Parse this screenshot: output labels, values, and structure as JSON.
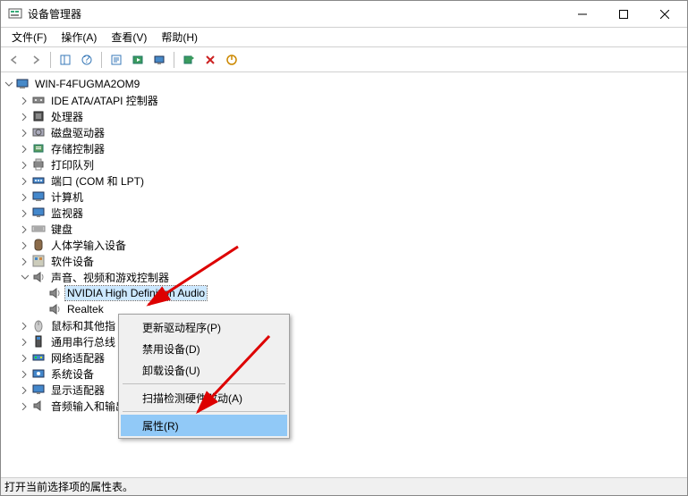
{
  "window": {
    "title": "设备管理器"
  },
  "menubar": {
    "file": "文件(F)",
    "action": "操作(A)",
    "view": "查看(V)",
    "help": "帮助(H)"
  },
  "statusbar": {
    "text": "打开当前选择项的属性表。"
  },
  "tree": {
    "root": "WIN-F4FUGMA2OM9",
    "nodes": [
      {
        "label": "IDE ATA/ATAPI 控制器",
        "icon": "ide"
      },
      {
        "label": "处理器",
        "icon": "cpu"
      },
      {
        "label": "磁盘驱动器",
        "icon": "disk"
      },
      {
        "label": "存储控制器",
        "icon": "storage"
      },
      {
        "label": "打印队列",
        "icon": "printer"
      },
      {
        "label": "端口 (COM 和 LPT)",
        "icon": "port"
      },
      {
        "label": "计算机",
        "icon": "computer"
      },
      {
        "label": "监视器",
        "icon": "monitor"
      },
      {
        "label": "键盘",
        "icon": "keyboard"
      },
      {
        "label": "人体学输入设备",
        "icon": "hid"
      },
      {
        "label": "软件设备",
        "icon": "software"
      }
    ],
    "sound_category": "声音、视频和游戏控制器",
    "sound_children": [
      {
        "label": "NVIDIA High Definition Audio",
        "selected": true
      },
      {
        "label": "Realtek"
      }
    ],
    "nodes_after": [
      {
        "label": "鼠标和其他指",
        "icon": "mouse"
      },
      {
        "label": "通用串行总线",
        "icon": "usb"
      },
      {
        "label": "网络适配器",
        "icon": "network"
      },
      {
        "label": "系统设备",
        "icon": "system"
      },
      {
        "label": "显示适配器",
        "icon": "display"
      },
      {
        "label": "音频输入和输出",
        "icon": "audio"
      }
    ]
  },
  "context_menu": {
    "update_driver": "更新驱动程序(P)",
    "disable": "禁用设备(D)",
    "uninstall": "卸载设备(U)",
    "scan": "扫描检测硬件改动(A)",
    "properties": "属性(R)"
  }
}
